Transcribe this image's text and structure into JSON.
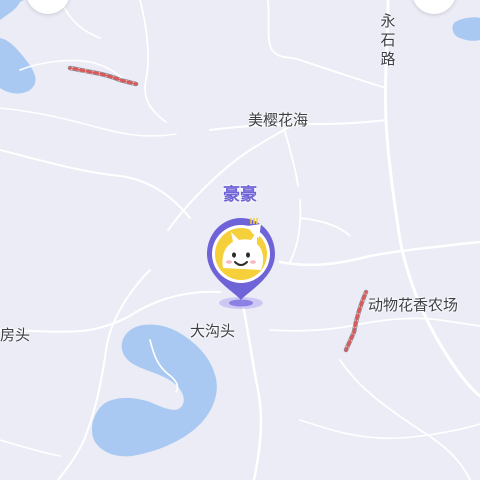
{
  "map": {
    "labels": {
      "road_yongshi": "永石路",
      "place_meiyinghuahai": "美樱花海",
      "place_dagoutou": "大沟头",
      "place_dongwu": "动物花香农场",
      "place_fangtou": "房头"
    },
    "pin": {
      "name": "豪豪",
      "accent_color": "#6f63d8",
      "avatar_bg": "#f6d03a",
      "avatar_icon": "cat-avatar-icon"
    },
    "colors": {
      "land": "#ebecf6",
      "water": "#a9c9f2",
      "road": "#ffffff",
      "rail_dash": "#d85a5a"
    }
  }
}
